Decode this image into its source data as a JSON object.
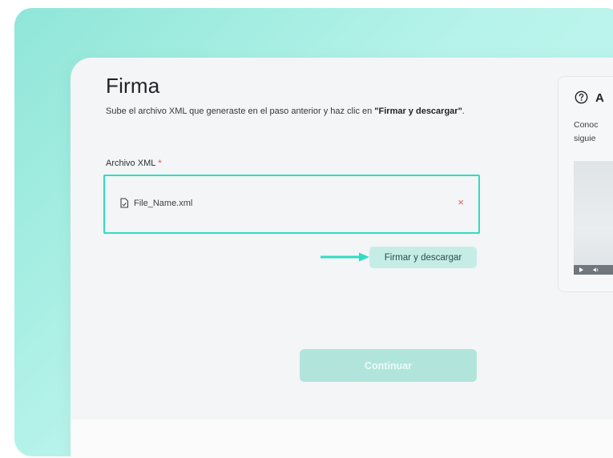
{
  "firma": {
    "title": "Firma",
    "description_prefix": "Sube el archivo XML que generaste en el paso anterior y haz clic en ",
    "description_bold": "\"Firmar y descargar\"",
    "description_suffix": ".",
    "field_label": "Archivo XML",
    "required_marker": "*",
    "file_name": "File_Name.xml",
    "remove_symbol": "×",
    "sign_button": "Firmar y descargar",
    "continue_button": "Continuar"
  },
  "help": {
    "title": "A",
    "text": "Conoc\nsiguie"
  },
  "icons": {
    "file": "file-icon",
    "remove": "close-icon",
    "arrow": "arrow-right-icon",
    "help": "question-circle-icon",
    "play": "play-icon",
    "volume": "volume-icon"
  },
  "colors": {
    "accent": "#2fdcc3",
    "button_bg": "#c5ede6",
    "continue_bg": "#b1e5dc",
    "remove": "#e35b5b",
    "required": "#e04a4a"
  }
}
